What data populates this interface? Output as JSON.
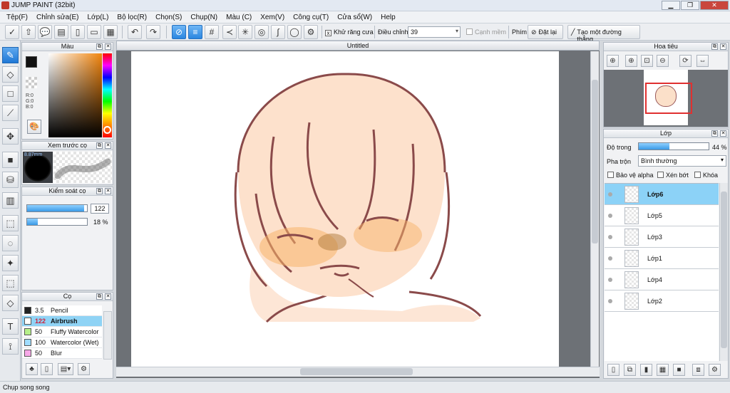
{
  "window": {
    "title": "JUMP PAINT (32bit)",
    "min": "▁",
    "max": "❐",
    "close": "✕"
  },
  "menu": [
    "Tệp(F)",
    "Chỉnh sửa(E)",
    "Lớp(L)",
    "Bộ lọc(R)",
    "Chọn(S)",
    "Chụp(N)",
    "Màu (C)",
    "Xem(V)",
    "Công cụ(T)",
    "Cửa sổ(W)",
    "Help"
  ],
  "toolbar": {
    "antialias_label": "Khử răng cưa",
    "antialias_checked": true,
    "adjust_label": "Điều chỉnh",
    "adjust_value": "39",
    "edge_label": "Cạnh mềm",
    "key_label": "Phím",
    "reset_label": "Đặt lại",
    "straight_line_label": "Tạo một đường thẳng"
  },
  "color_panel": {
    "title": "Màu",
    "r": "R:0",
    "g": "G:0",
    "b": "B:0",
    "foreground": "#111111",
    "background": "#ffffff"
  },
  "brush_preview": {
    "title": "Xem trước cọ",
    "size": "8.87mm"
  },
  "brush_control": {
    "title": "Kiểm soát cọ",
    "size_value": "122",
    "size_fraction": 0.95,
    "opacity_value": "18 %",
    "opacity_fraction": 0.18
  },
  "brush_panel": {
    "title": "Cọ",
    "brushes": [
      {
        "size": "3.5",
        "name": "Pencil",
        "color": "#222222"
      },
      {
        "size": "122",
        "name": "Airbrush",
        "color": "#ffffff"
      },
      {
        "size": "50",
        "name": "Fluffy Watercolor",
        "color": "#b6f08a"
      },
      {
        "size": "100",
        "name": "Watercolor (Wet)",
        "color": "#9fdcff"
      },
      {
        "size": "50",
        "name": "Blur",
        "color": "#f7a8e8"
      }
    ],
    "selected_index": 1
  },
  "canvas": {
    "tab_title": "Untitled"
  },
  "navigator": {
    "title": "Hoa tiêu"
  },
  "layers_panel": {
    "title": "Lớp",
    "opacity_label": "Độ trong",
    "opacity_value": "44 %",
    "opacity_fraction": 0.44,
    "blend_label": "Pha trộn",
    "blend_value": "Bình thường",
    "protect_alpha": "Bảo vệ alpha",
    "clip": "Xén bớt",
    "lock": "Khóa",
    "layers": [
      {
        "name": "Lớp6",
        "selected": true
      },
      {
        "name": "Lớp5",
        "selected": false
      },
      {
        "name": "Lớp3",
        "selected": false
      },
      {
        "name": "Lớp1",
        "selected": false
      },
      {
        "name": "Lớp4",
        "selected": false
      },
      {
        "name": "Lớp2",
        "selected": false
      }
    ]
  },
  "status": {
    "text": "Chụp song song"
  }
}
